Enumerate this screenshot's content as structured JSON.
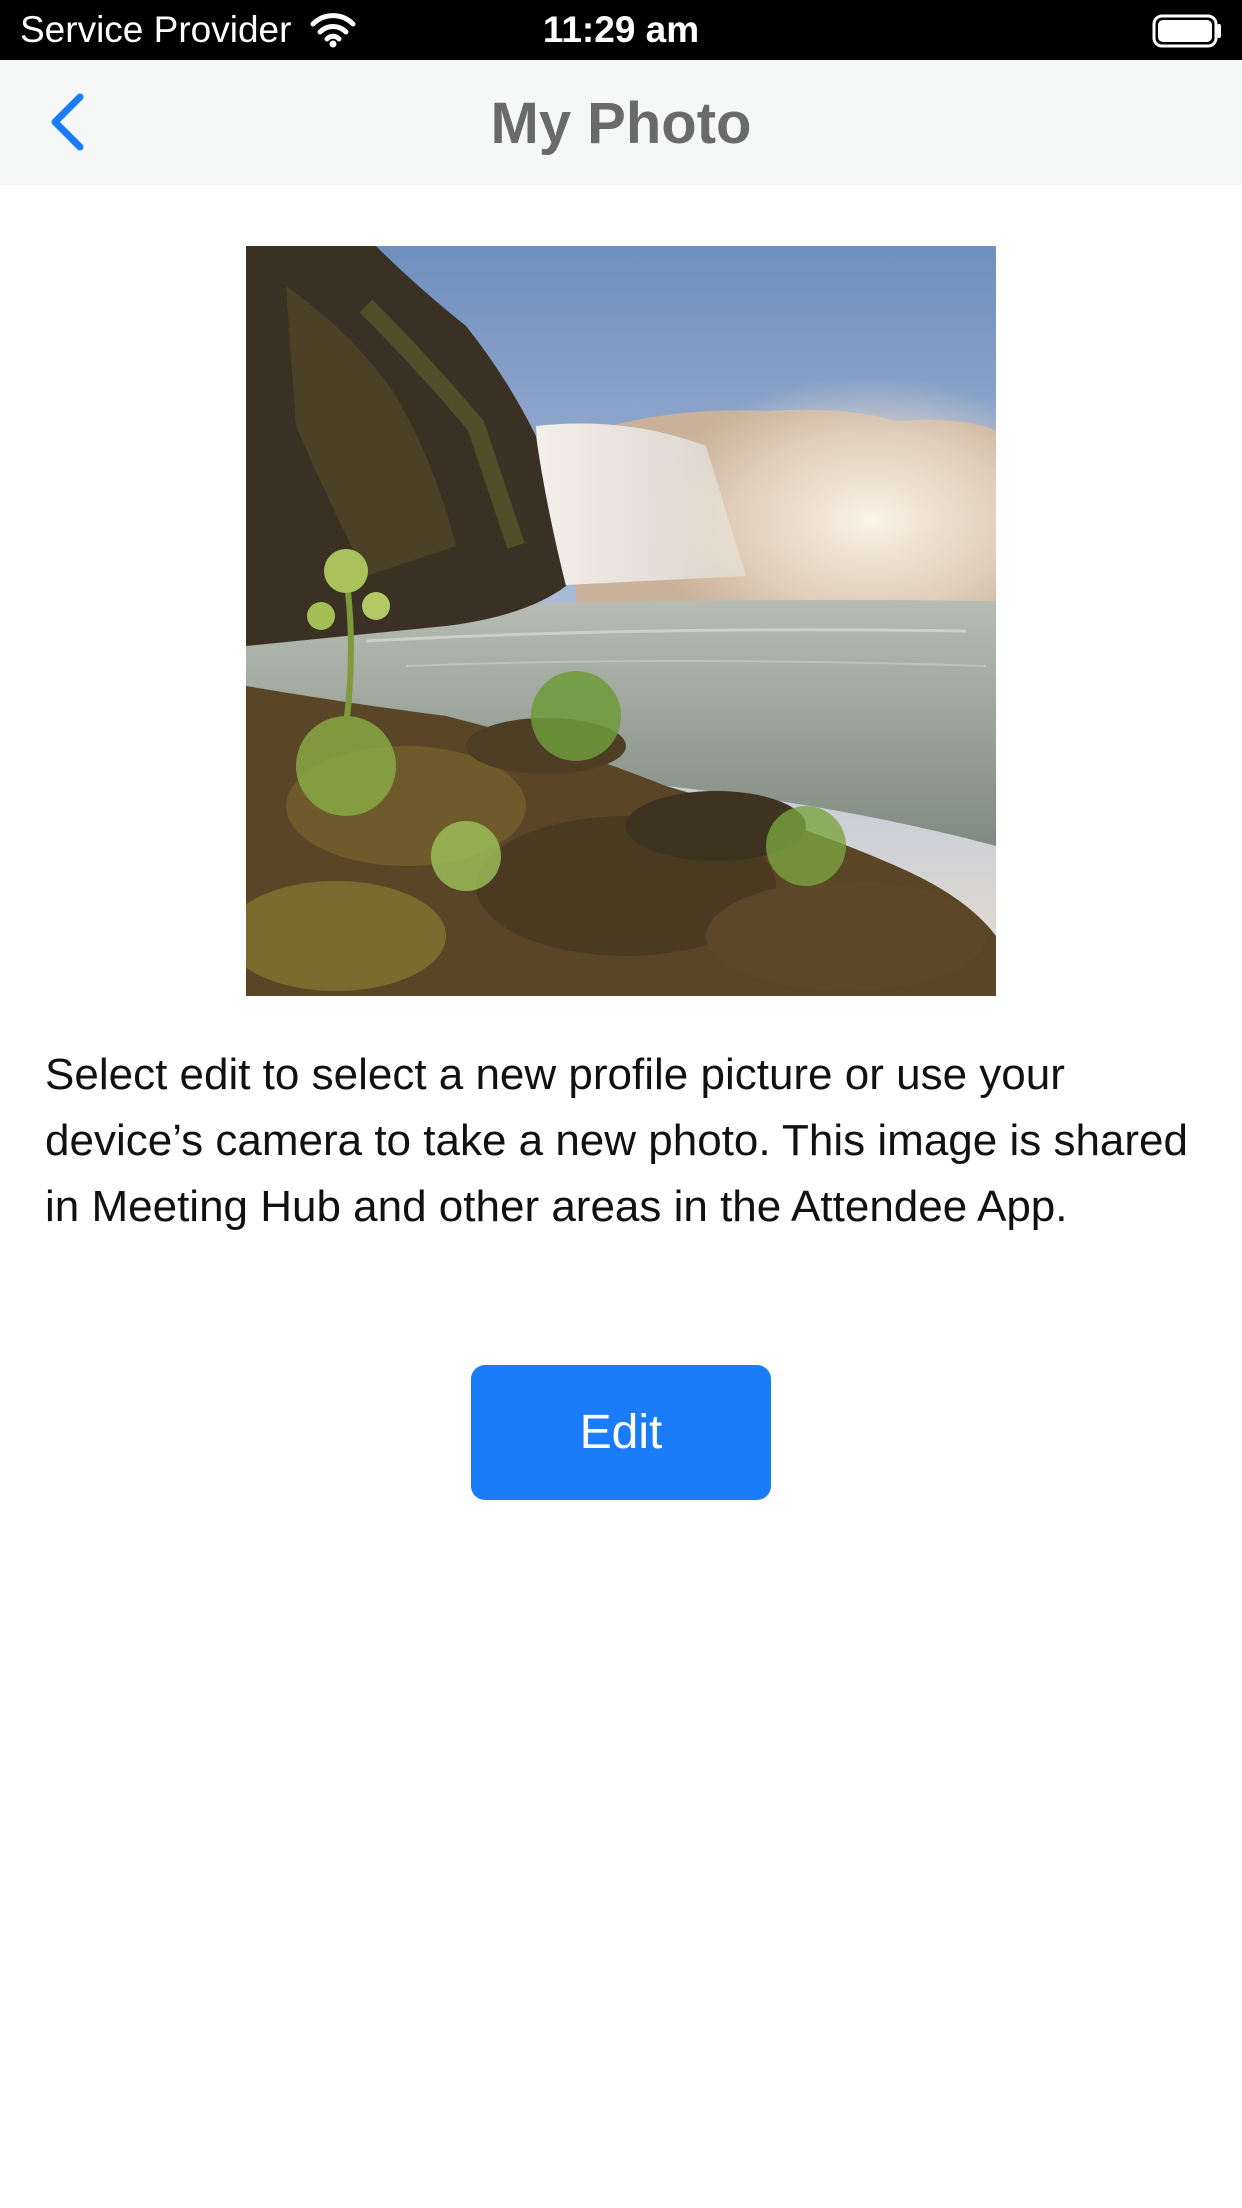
{
  "status_bar": {
    "carrier": "Service Provider",
    "time": "11:29 am",
    "wifi_icon": "wifi-icon",
    "battery_icon": "battery-full-icon"
  },
  "nav": {
    "title": "My Photo",
    "back_icon": "chevron-left-icon",
    "back_color": "#1a7cf8"
  },
  "photo": {
    "subject": "waterfall landscape profile picture"
  },
  "description": "Select edit to select a new profile picture or use your device’s camera to take a new photo. This image is shared in Meeting Hub and other areas in the Attendee App.",
  "actions": {
    "edit_label": "Edit",
    "edit_color": "#1a7cf8"
  }
}
